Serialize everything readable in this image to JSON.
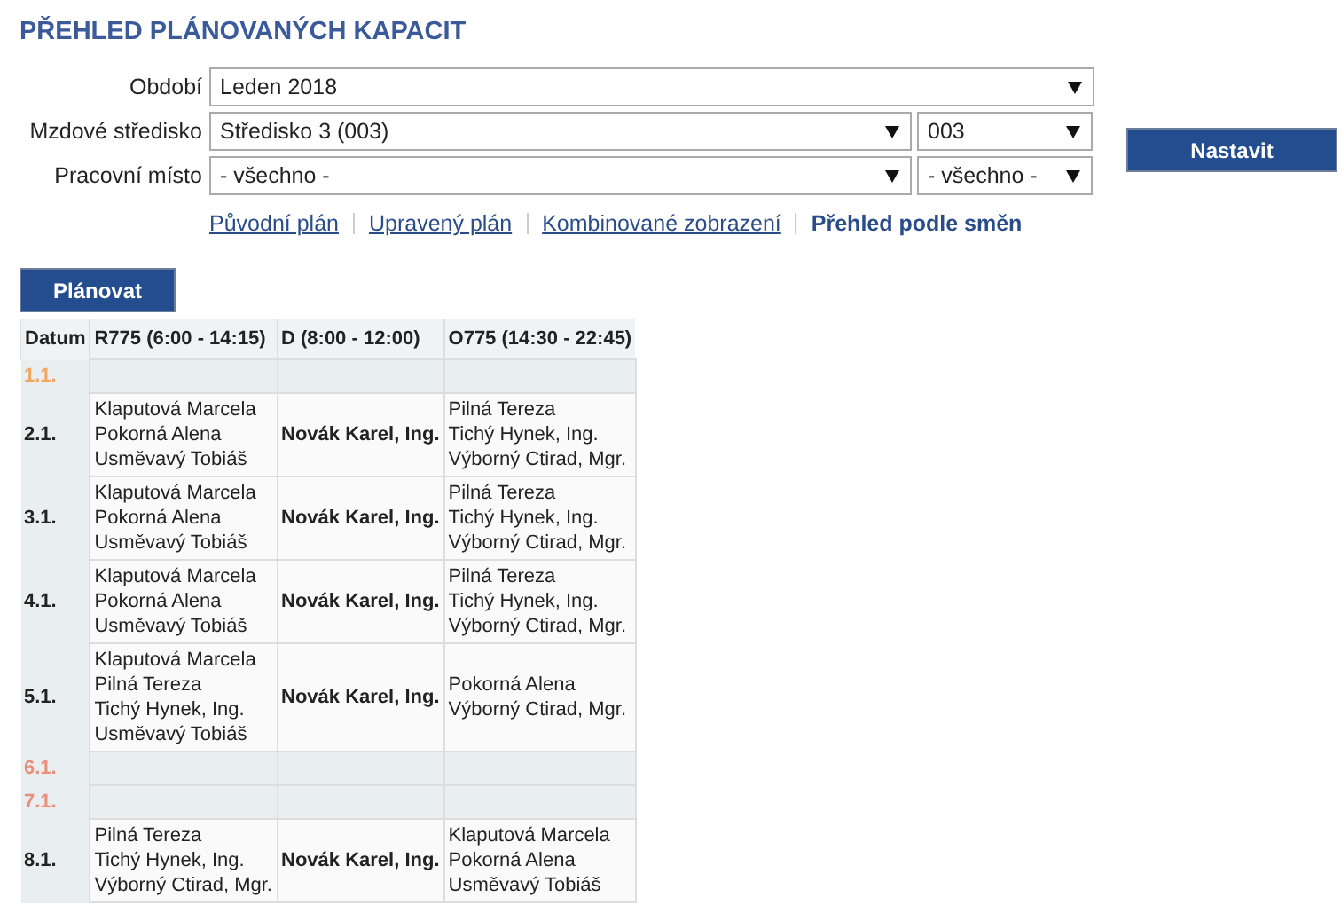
{
  "title": "PŘEHLED PLÁNOVANÝCH KAPACIT",
  "filters": [
    {
      "label": "Období",
      "value": "Leden 2018"
    },
    {
      "label": "Mzdové středisko",
      "value": "Středisko 3 (003)",
      "secondary": "003"
    },
    {
      "label": "Pracovní místo",
      "value": "- všechno -",
      "secondary": "- všechno -"
    }
  ],
  "apply_button": "Nastavit",
  "views": [
    {
      "label": "Původní plán",
      "selected": false
    },
    {
      "label": "Upravený plán",
      "selected": false
    },
    {
      "label": "Kombinované zobrazení",
      "selected": false
    },
    {
      "label": "Přehled podle směn",
      "selected": true
    }
  ],
  "plan_button": "Plánovat",
  "table": {
    "columns": [
      "Datum",
      "R775 (6:00 - 14:15)",
      "D (8:00 - 12:00)",
      "O775 (14:30 - 22:45)"
    ],
    "rows": [
      {
        "kind": "holiday",
        "cells": [
          "1.1.",
          "",
          "",
          ""
        ]
      },
      {
        "kind": "workday",
        "cells": [
          "2.1.",
          "Klaputová Marcela\nPokorná Alena\nUsměvavý Tobiáš",
          "Novák Karel, Ing.",
          "Pilná Tereza\nTichý Hynek, Ing.\nVýborný Ctirad, Mgr."
        ]
      },
      {
        "kind": "workday",
        "cells": [
          "3.1.",
          "Klaputová Marcela\nPokorná Alena\nUsměvavý Tobiáš",
          "Novák Karel, Ing.",
          "Pilná Tereza\nTichý Hynek, Ing.\nVýborný Ctirad, Mgr."
        ]
      },
      {
        "kind": "workday",
        "cells": [
          "4.1.",
          "Klaputová Marcela\nPokorná Alena\nUsměvavý Tobiáš",
          "Novák Karel, Ing.",
          "Pilná Tereza\nTichý Hynek, Ing.\nVýborný Ctirad, Mgr."
        ]
      },
      {
        "kind": "workday",
        "cells": [
          "5.1.",
          "Klaputová Marcela\nPilná Tereza\nTichý Hynek, Ing.\nUsměvavý Tobiáš",
          "Novák Karel, Ing.",
          "Pokorná Alena\nVýborný Ctirad, Mgr."
        ]
      },
      {
        "kind": "weekend",
        "cells": [
          "6.1.",
          "",
          "",
          ""
        ]
      },
      {
        "kind": "weekend",
        "cells": [
          "7.1.",
          "",
          "",
          ""
        ]
      },
      {
        "kind": "workday",
        "cells": [
          "8.1.",
          "Pilná Tereza\nTichý Hynek, Ing.\nVýborný Ctirad, Mgr.",
          "Novák Karel, Ing.",
          "Klaputová Marcela\nPokorná Alena\nUsměvavý Tobiáš"
        ]
      }
    ]
  }
}
